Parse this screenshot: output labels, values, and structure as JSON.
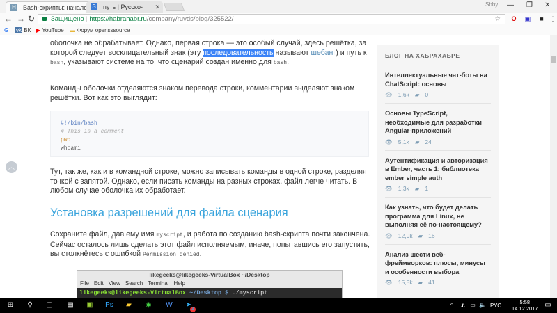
{
  "browser": {
    "tabs": [
      {
        "label": "Bash-скрипты: начало /",
        "favicon": "H"
      },
      {
        "label": "путь | Русско-казахский",
        "favicon": "S"
      }
    ],
    "window_user": "Sbby",
    "url_secure": "Защищено",
    "url_host": "https://habrahabr.ru",
    "url_path": "/company/ruvds/blog/325522/",
    "ext_badges": [
      "3",
      "",
      "2"
    ]
  },
  "bookmarks": [
    {
      "label": "",
      "icon": "google-icon"
    },
    {
      "label": "ВК",
      "icon": "vk-icon"
    },
    {
      "label": "YouTube",
      "icon": "youtube-icon"
    },
    {
      "label": "Форум opensssource",
      "icon": "folder-icon"
    }
  ],
  "article": {
    "p1": {
      "a": "оболочка не обрабатывает. Однако, первая строка — это особый случай, здесь решётка, за которой следует восклицательный знак (эту ",
      "sel": "последовательность",
      "b": " называют ",
      "link": "шебанг",
      "c": ") и путь к ",
      "code": "bash",
      "d": ", указывают системе на то, что сценарий создан именно для ",
      "code2": "bash",
      "e": "."
    },
    "p2": "Команды оболочки отделяются знаком перевода строки, комментарии выделяют знаком решётки. Вот как это выглядит:",
    "code_lines": [
      "#!/bin/bash",
      "# This is a comment",
      "pwd",
      "whoami"
    ],
    "p3": "Тут, так же, как и в командной строке, можно записывать команды в одной строке, разделяя точкой с запятой. Однако, если писать команды на разных строках, файл легче читать. В любом случае оболочка их обработает.",
    "heading": "Установка разрешений для файла сценария",
    "p4": {
      "a": "Сохраните файл, дав ему имя ",
      "code": "myscript",
      "b": ", и работа по созданию bash-скрипта почти закончена. Сейчас осталось лишь сделать этот файл исполняемым, иначе, попытавшись его запустить, вы столкнётесь с ошибкой ",
      "code2": "Permission denied",
      "c": "."
    },
    "terminal": {
      "title": "likegeeks@likegeeks-VirtualBox ~/Desktop",
      "menu": [
        "File",
        "Edit",
        "View",
        "Search",
        "Terminal",
        "Help"
      ],
      "prompt": "likegeeks@likegeeks-VirtualBox",
      "path": " ~/Desktop $",
      "cmd": " ./myscript"
    }
  },
  "sidebar": {
    "title": "БЛОГ НА ХАБРАХАБРЕ",
    "items": [
      {
        "title": "Интеллектуальные чат-боты на ChatScript: основы",
        "views": "1,6k",
        "comments": "0"
      },
      {
        "title": "Основы TypeScript, необходимые для разработки Angular-приложений",
        "views": "5,1k",
        "comments": "24"
      },
      {
        "title": "Аутентификация и авторизация в Ember, часть 1: библиотека ember simple auth",
        "views": "1,3k",
        "comments": "1"
      },
      {
        "title": "Как узнать, что будет делать программа для Linux, не выполняя её по-настоящему?",
        "views": "12,9k",
        "comments": "16"
      },
      {
        "title": "Анализ шести веб-фреймворков: плюсы, минусы и особенности выбора",
        "views": "15,5k",
        "comments": "41"
      },
      {
        "title": "Двенадцать советов по повышению",
        "views": "",
        "comments": ""
      }
    ]
  },
  "taskbar": {
    "lang": "РУС",
    "time": "5:58",
    "date": "14.12.2017",
    "badge": "4"
  }
}
